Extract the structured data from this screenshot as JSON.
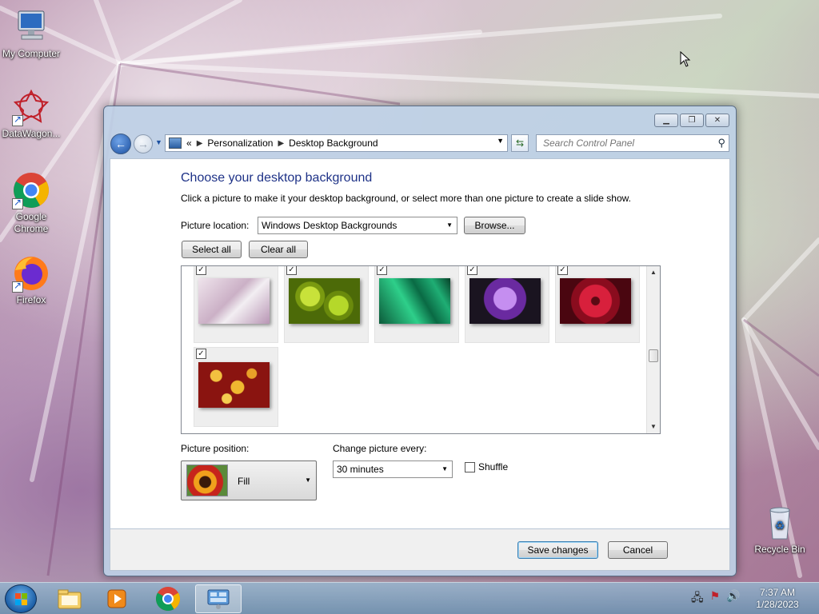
{
  "desktop": {
    "icons": [
      {
        "label": "My Computer",
        "icon": "computer-icon"
      },
      {
        "label": "DataWagon...",
        "icon": "datawagon-icon"
      },
      {
        "label": "Google Chrome",
        "icon": "chrome-icon"
      },
      {
        "label": "Firefox",
        "icon": "firefox-icon"
      },
      {
        "label": "Recycle Bin",
        "icon": "recycle-bin-icon"
      }
    ]
  },
  "window": {
    "address": {
      "overflow": "«",
      "crumb1": "Personalization",
      "crumb2": "Desktop Background"
    },
    "search_placeholder": "Search Control Panel",
    "title": "Choose your desktop background",
    "subtitle": "Click a picture to make it your desktop background, or select more than one picture to create a slide show.",
    "picture_location_label": "Picture location:",
    "picture_location_value": "Windows Desktop Backgrounds",
    "browse_label": "Browse...",
    "select_all_label": "Select all",
    "clear_all_label": "Clear all",
    "pictures": [
      {
        "checked": true,
        "desc": "pink-spines"
      },
      {
        "checked": true,
        "desc": "green-succulents"
      },
      {
        "checked": true,
        "desc": "green-leaves"
      },
      {
        "checked": true,
        "desc": "purple-thistle"
      },
      {
        "checked": true,
        "desc": "red-dahlia"
      },
      {
        "checked": true,
        "desc": "autumn-leaves"
      }
    ],
    "picture_position_label": "Picture position:",
    "picture_position_value": "Fill",
    "change_every_label": "Change picture every:",
    "change_every_value": "30 minutes",
    "shuffle_label": "Shuffle",
    "shuffle_checked": false,
    "save_label": "Save changes",
    "cancel_label": "Cancel"
  },
  "taskbar": {
    "time": "7:37 AM",
    "date": "1/28/2023"
  }
}
